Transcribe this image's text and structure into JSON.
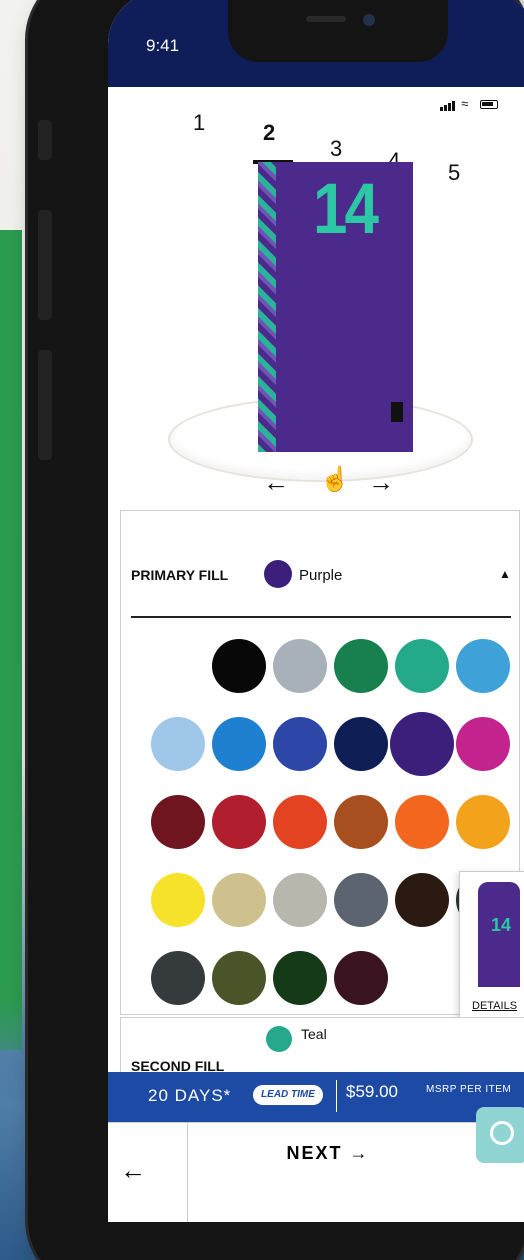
{
  "status_bar": {
    "time": "9:41"
  },
  "steps": [
    "1",
    "2",
    "3",
    "4",
    "5"
  ],
  "active_step": "2",
  "jersey": {
    "number": "14",
    "color": "#4b2a8c",
    "accent": "#2cc7a5"
  },
  "rotate": {
    "left": "←",
    "hand": "☝",
    "right": "→"
  },
  "primary_fill": {
    "label": "PRIMARY FILL",
    "selected_name": "Purple",
    "selected_color": "#3b1f7a",
    "caret": "▲",
    "swatches": [
      "#ffffff",
      "#080808",
      "#a8b1ba",
      "#18804f",
      "#24a98b",
      "#3ea1d8",
      "#9ec7ea",
      "#1f7fd0",
      "#2c47a7",
      "#0f1f55",
      "#3b1f7a",
      "#c2238c",
      "#6e1520",
      "#b11f2e",
      "#e34320",
      "#a84f20",
      "#f2661d",
      "#f3a21b",
      "#f6e22a",
      "#cfc18d",
      "#b7b7ae",
      "#5b6470",
      "#2a1a12",
      "#2a3433",
      "#353b3c",
      "#4b5428",
      "#153a18",
      "#3a1420"
    ]
  },
  "details": {
    "number": "14",
    "link": "DETAILS"
  },
  "second_fill": {
    "label": "SECOND FILL",
    "selected_name": "Teal",
    "selected_color": "#25a88c"
  },
  "lead": {
    "days": "20 DAYS*",
    "pill": "LEAD TIME",
    "price": "$59.00",
    "msrp": "MSRP PER ITEM"
  },
  "nav": {
    "back": "←",
    "next": "NEXT →"
  }
}
